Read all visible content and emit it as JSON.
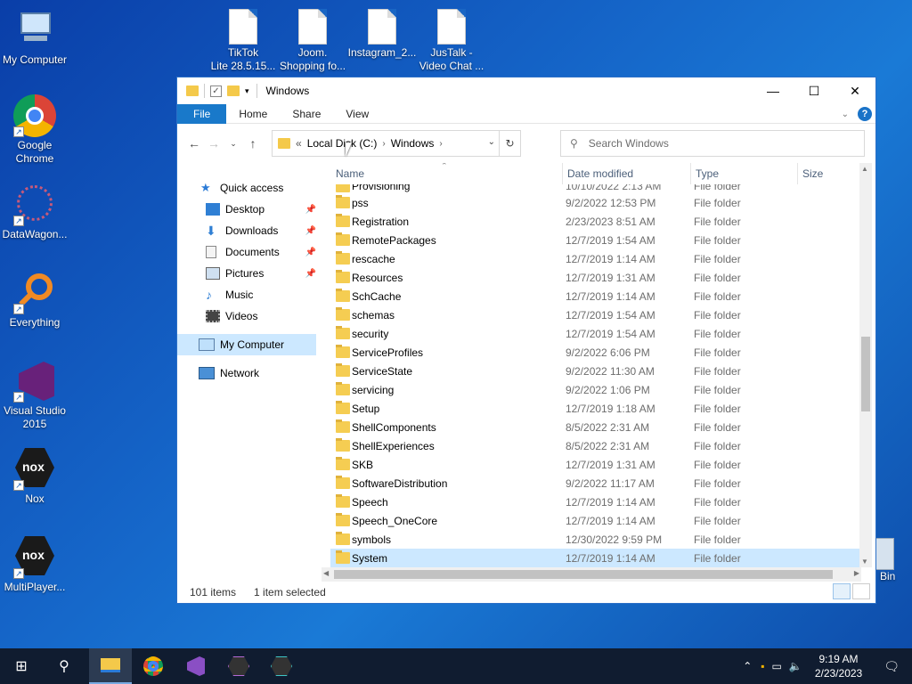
{
  "desktop": {
    "icons": [
      {
        "label": "My Computer"
      },
      {
        "label": "Google\nChrome"
      },
      {
        "label": "DataWagon..."
      },
      {
        "label": "Everything"
      },
      {
        "label": "Visual Studio\n2015"
      },
      {
        "label": "Nox"
      },
      {
        "label": "MultiPlayer..."
      },
      {
        "label": "TikTok\nLite 28.5.15..."
      },
      {
        "label": "Joom.\nShopping fo..."
      },
      {
        "label": "Instagram_2..."
      },
      {
        "label": "JusTalk -\nVideo Chat ..."
      },
      {
        "label": "Bin"
      }
    ]
  },
  "window": {
    "title": "Windows",
    "ribbon": {
      "file": "File",
      "home": "Home",
      "share": "Share",
      "view": "View"
    },
    "address": {
      "prefix": "«",
      "crumb1": "Local Disk (C:)",
      "crumb2": "Windows"
    },
    "search": {
      "placeholder": "Search Windows"
    },
    "nav": {
      "quick_access": "Quick access",
      "desktop": "Desktop",
      "downloads": "Downloads",
      "documents": "Documents",
      "pictures": "Pictures",
      "music": "Music",
      "videos": "Videos",
      "my_computer": "My Computer",
      "network": "Network"
    },
    "columns": {
      "name": "Name",
      "date": "Date modified",
      "type": "Type",
      "size": "Size"
    },
    "partial_row": {
      "name": "Provisioning",
      "date": "10/10/2022 2:13 AM",
      "type": "File folder"
    },
    "rows": [
      {
        "name": "pss",
        "date": "9/2/2022 12:53 PM",
        "type": "File folder"
      },
      {
        "name": "Registration",
        "date": "2/23/2023 8:51 AM",
        "type": "File folder"
      },
      {
        "name": "RemotePackages",
        "date": "12/7/2019 1:54 AM",
        "type": "File folder"
      },
      {
        "name": "rescache",
        "date": "12/7/2019 1:14 AM",
        "type": "File folder"
      },
      {
        "name": "Resources",
        "date": "12/7/2019 1:31 AM",
        "type": "File folder"
      },
      {
        "name": "SchCache",
        "date": "12/7/2019 1:14 AM",
        "type": "File folder"
      },
      {
        "name": "schemas",
        "date": "12/7/2019 1:54 AM",
        "type": "File folder"
      },
      {
        "name": "security",
        "date": "12/7/2019 1:54 AM",
        "type": "File folder"
      },
      {
        "name": "ServiceProfiles",
        "date": "9/2/2022 6:06 PM",
        "type": "File folder"
      },
      {
        "name": "ServiceState",
        "date": "9/2/2022 11:30 AM",
        "type": "File folder"
      },
      {
        "name": "servicing",
        "date": "9/2/2022 1:06 PM",
        "type": "File folder"
      },
      {
        "name": "Setup",
        "date": "12/7/2019 1:18 AM",
        "type": "File folder"
      },
      {
        "name": "ShellComponents",
        "date": "8/5/2022 2:31 AM",
        "type": "File folder"
      },
      {
        "name": "ShellExperiences",
        "date": "8/5/2022 2:31 AM",
        "type": "File folder"
      },
      {
        "name": "SKB",
        "date": "12/7/2019 1:31 AM",
        "type": "File folder"
      },
      {
        "name": "SoftwareDistribution",
        "date": "9/2/2022 11:17 AM",
        "type": "File folder"
      },
      {
        "name": "Speech",
        "date": "12/7/2019 1:14 AM",
        "type": "File folder"
      },
      {
        "name": "Speech_OneCore",
        "date": "12/7/2019 1:14 AM",
        "type": "File folder"
      },
      {
        "name": "symbols",
        "date": "12/30/2022 9:59 PM",
        "type": "File folder"
      },
      {
        "name": "System",
        "date": "12/7/2019 1:14 AM",
        "type": "File folder"
      }
    ],
    "status": {
      "count": "101 items",
      "selected": "1 item selected"
    }
  },
  "taskbar": {
    "time": "9:19 AM",
    "date": "2/23/2023"
  },
  "colors": {
    "accent": "#1979ca",
    "selection": "#cce8ff",
    "folder": "#f5cd52"
  }
}
